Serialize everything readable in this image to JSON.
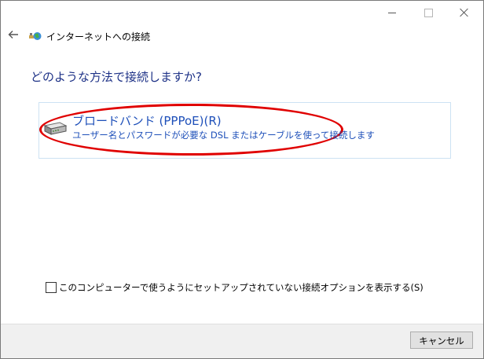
{
  "window": {
    "title": "インターネットへの接続",
    "controls": {
      "minimize": "minimize-icon",
      "maximize": "maximize-icon",
      "close": "close-icon"
    }
  },
  "nav": {
    "back_icon": "back-arrow-icon"
  },
  "heading": "どのような方法で接続しますか?",
  "options": [
    {
      "icon": "modem-icon",
      "title": "ブロードバンド (PPPoE)(R)",
      "description": "ユーザー名とパスワードが必要な DSL またはケーブルを使って接続します",
      "highlighted": true
    }
  ],
  "checkbox": {
    "label": "このコンピューターで使うようにセットアップされていない接続オプションを表示する(S)",
    "checked": false
  },
  "footer": {
    "cancel_label": "キャンセル"
  },
  "colors": {
    "heading": "#1e3287",
    "link": "#1d4fb9",
    "highlight_ring": "#e00000",
    "panel_border": "#cde2f3",
    "footer_bg": "#f0f0f0"
  }
}
